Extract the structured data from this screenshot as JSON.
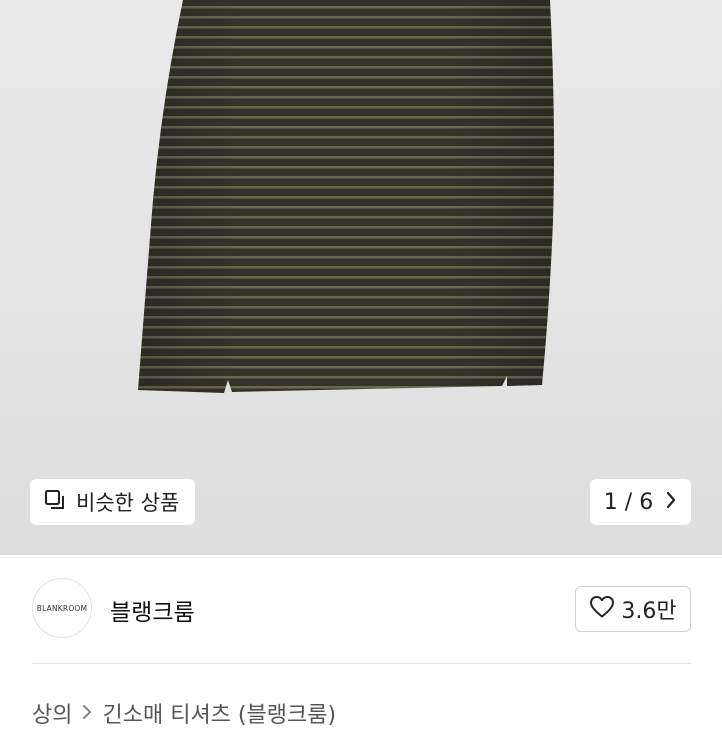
{
  "gallery": {
    "similar_label": "비슷한 상품",
    "pager_text": "1 / 6",
    "current_index": 1,
    "total": 6,
    "colors": {
      "background": "#e6e6e6",
      "garment_base": "#36352b",
      "garment_stripe": "#6b6852"
    }
  },
  "seller": {
    "avatar_text": "BLANKROOM",
    "name": "블랭크룸",
    "likes": "3.6만"
  },
  "breadcrumb": {
    "items": [
      "상의",
      "긴소매 티셔츠 (블랭크룸)"
    ]
  },
  "icons": {
    "similar": "copy-icon",
    "pager": "chevron-right-icon",
    "like": "heart-icon",
    "breadcrumb_sep": "chevron-right-icon"
  }
}
